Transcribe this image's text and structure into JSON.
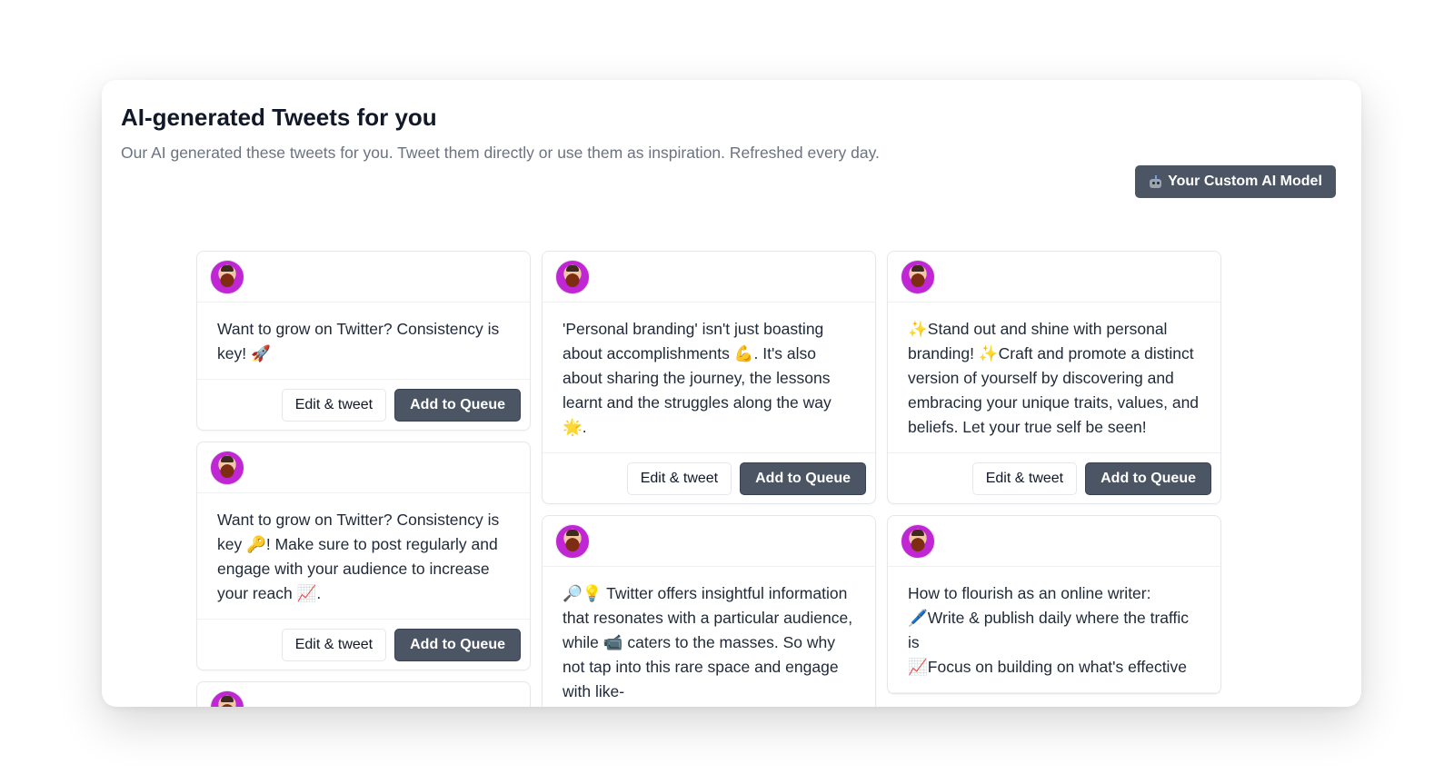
{
  "header": {
    "title": "AI-generated Tweets for you",
    "subtitle": "Our AI generated these tweets for you. Tweet them directly or use them as inspiration. Refreshed every day.",
    "custom_model_label": "Your Custom AI Model",
    "custom_model_icon": "robot-icon"
  },
  "buttons": {
    "edit_label": "Edit & tweet",
    "queue_label": "Add to Queue"
  },
  "columns": [
    {
      "cards": [
        {
          "text": "Want to grow on Twitter? Consistency is key! 🚀",
          "show_actions": true
        },
        {
          "text": "Want to grow on Twitter? Consistency is key 🔑! Make sure to post regularly and engage with your audience to increase your reach 📈.",
          "show_actions": true
        },
        {
          "text": "",
          "show_actions": false
        }
      ]
    },
    {
      "cards": [
        {
          "text": "'Personal branding' isn't just boasting about accomplishments 💪. It's also about sharing the journey, the lessons learnt and the struggles along the way 🌟.",
          "show_actions": true
        },
        {
          "text": "🔎💡 Twitter offers insightful information that resonates with a particular audience, while 📹 caters to the masses. So why not tap into this rare space and engage with like-",
          "show_actions": false
        }
      ]
    },
    {
      "cards": [
        {
          "text": "✨Stand out and shine with personal branding! ✨Craft and promote a distinct version of yourself by discovering and embracing your unique traits, values, and beliefs. Let your true self be seen!",
          "show_actions": true
        },
        {
          "text": "How to flourish as an online writer:\n🖊️Write & publish daily where the traffic is\n📈Focus on building on what's effective",
          "show_actions": false
        }
      ]
    }
  ],
  "colors": {
    "primary_button": "#4b5563",
    "text": "#1f2937",
    "muted": "#6b7280"
  }
}
